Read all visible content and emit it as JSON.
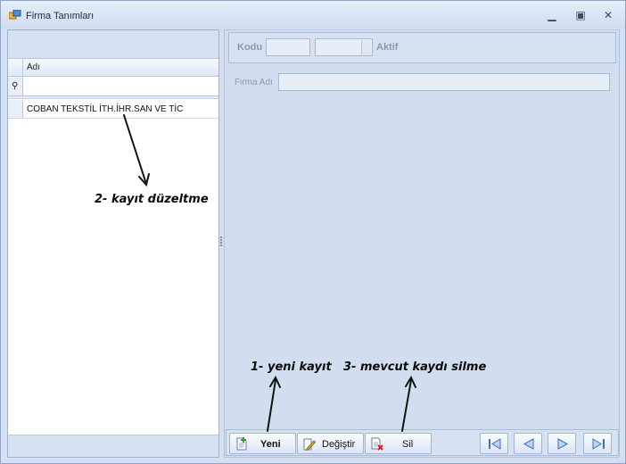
{
  "window": {
    "title": "Firma Tanımları",
    "minimize_glyph": "▁",
    "restore_glyph": "▣",
    "close_glyph": "✕"
  },
  "grid": {
    "column_header": "Adı",
    "filter_value": "",
    "rows": [
      {
        "adi": "COBAN TEKSTİL İTH.İHR.SAN VE TİC"
      }
    ]
  },
  "form": {
    "kodu_label": "Kodu",
    "kodu_value": "",
    "aktif_label": "Aktif",
    "firma_adi_label": "Firma Adı",
    "firma_adi_value": ""
  },
  "toolbar": {
    "yeni_label": "Yeni",
    "degistir_label": "Değiştir",
    "sil_label": "Sil"
  },
  "icons": {
    "app": "app-window-icon",
    "new": "new-document-icon",
    "edit": "edit-pencil-icon",
    "delete": "delete-document-icon",
    "first": "first-record-icon",
    "prev": "previous-record-icon",
    "next": "next-record-icon",
    "last": "last-record-icon"
  },
  "annotations": {
    "edit_note": "2- kayıt düzeltme",
    "new_note": "1- yeni kayıt",
    "delete_note": "3- mevcut kaydı silme"
  },
  "colors": {
    "window_bg": "#d4e0f1",
    "panel_border": "#a9bcd8",
    "nav_icon": "#3f6fc4"
  }
}
